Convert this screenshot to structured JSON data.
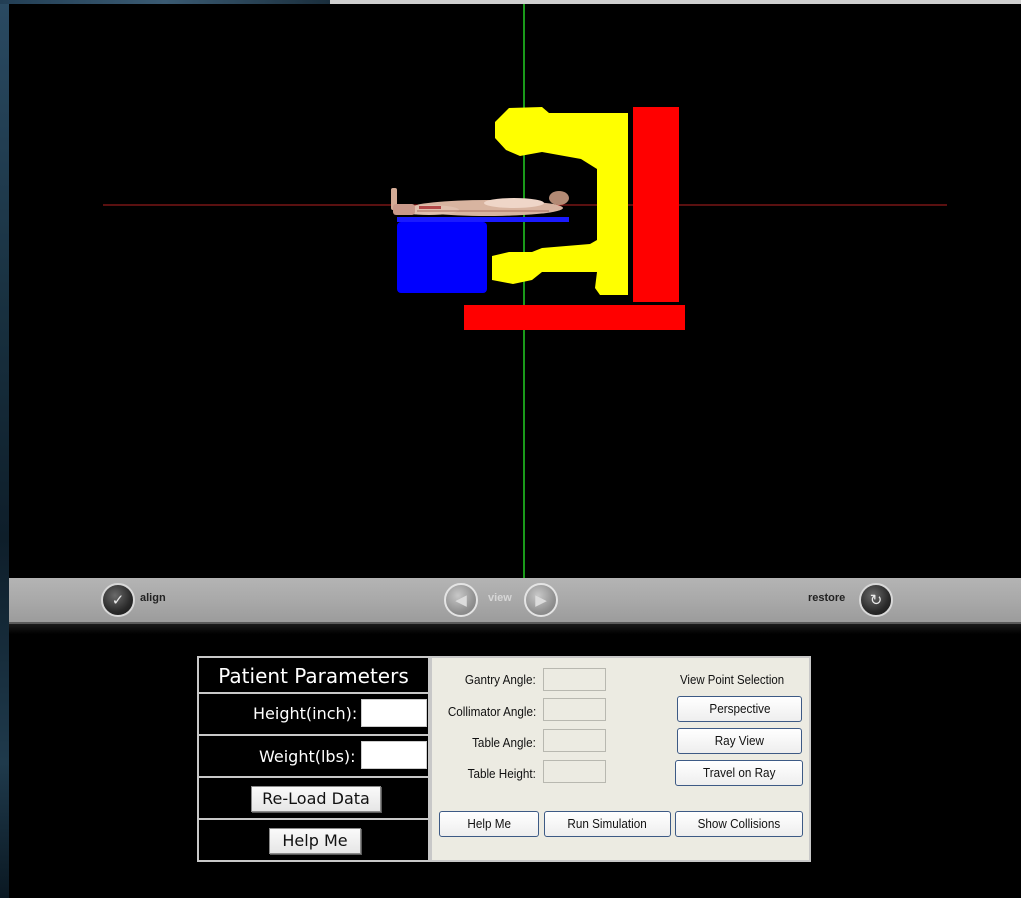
{
  "toolbar": {
    "align_label": "align",
    "view_label": "view",
    "restore_label": "restore"
  },
  "scene": {
    "axis_x_color": "#b31f1f",
    "axis_y_color": "#1a9a1a",
    "table_color": "#0000ff",
    "gantry_color": "#ffff00",
    "stand_color": "#ff0000"
  },
  "patient_panel": {
    "title": "Patient Parameters",
    "height_label": "Height(inch):",
    "height_value": "",
    "weight_label": "Weight(lbs):",
    "weight_value": "",
    "reload_button": "Re-Load Data",
    "help_button": "Help Me"
  },
  "control_panel": {
    "gantry_angle_label": "Gantry Angle:",
    "collimator_angle_label": "Collimator Angle:",
    "table_angle_label": "Table Angle:",
    "table_height_label": "Table Height:",
    "gantry_angle_value": "",
    "collimator_angle_value": "",
    "table_angle_value": "",
    "table_height_value": "",
    "view_point_selection_label": "View Point Selection",
    "perspective_button": "Perspective",
    "ray_view_button": "Ray View",
    "travel_on_ray_button": "Travel on Ray",
    "help_button": "Help Me",
    "run_simulation_button": "Run Simulation",
    "show_collisions_button": "Show Collisions"
  }
}
